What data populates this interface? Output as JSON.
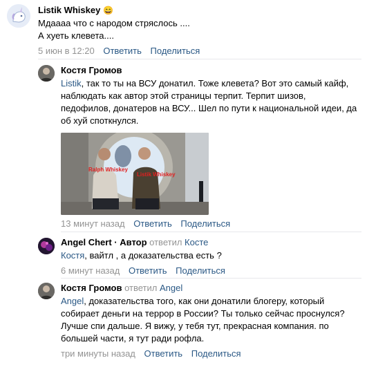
{
  "comments": [
    {
      "author": "Listik Whiskey",
      "emoji": "😄",
      "lines": [
        "Мдаааа что с народом стряслось ....",
        "А хуеть клевета...."
      ],
      "date": "5 июн в 12:20",
      "reply": "Ответить",
      "share": "Поделиться"
    },
    {
      "author": "Костя Громов",
      "mention": "Listik",
      "text": ", так то ты на ВСУ донатил. Тоже клевета? Вот это самый кайф, наблюдать как автор этой страницы терпит. Терпит шизов, педофилов, донатеров на ВСУ... Шел по пути к национальной идеи, да об хуй споткнулся.",
      "photo_labels": [
        "Ralph Whiskey",
        "Listik Whiskey"
      ],
      "date": "13 минут назад",
      "reply": "Ответить",
      "share": "Поделиться"
    },
    {
      "author": "Angel Chert",
      "author_suffix": "· Автор",
      "replied_word": "ответил",
      "replied_to": "Косте",
      "mention": "Костя",
      "text": ", вайтл , а доказательства есть ?",
      "date": "6 минут назад",
      "reply": "Ответить",
      "share": "Поделиться"
    },
    {
      "author": "Костя Громов",
      "replied_word": "ответил",
      "replied_to": "Angel",
      "mention": "Angel",
      "text": ", доказательства того, как они донатили блогеру, который собирает деньги на террор в России? Ты только сейчас проснулся? Лучше спи дальше. Я вижу, у тебя тут, прекрасная компания. по большей части, я тут ради рофла.",
      "date": "три минуты назад",
      "reply": "Ответить",
      "share": "Поделиться"
    }
  ],
  "colors": {
    "link": "#2a5885",
    "meta": "#939393",
    "divider": "#e7e8ec"
  }
}
